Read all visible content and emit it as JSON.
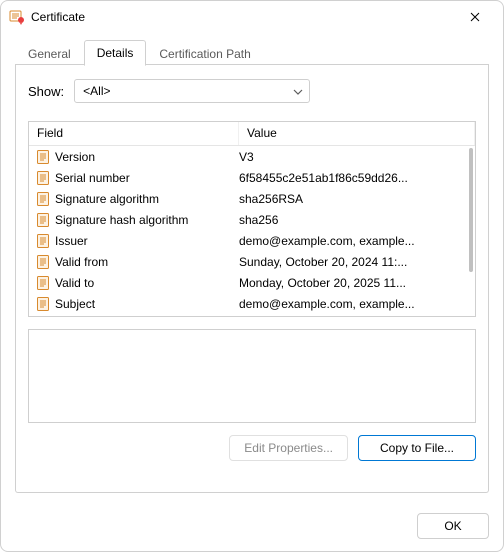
{
  "window": {
    "title": "Certificate"
  },
  "tabs": [
    {
      "id": "general",
      "label": "General"
    },
    {
      "id": "details",
      "label": "Details"
    },
    {
      "id": "certpath",
      "label": "Certification Path"
    }
  ],
  "active_tab": "details",
  "show": {
    "label": "Show:",
    "selected": "<All>"
  },
  "columns": {
    "field": "Field",
    "value": "Value"
  },
  "rows": [
    {
      "field": "Version",
      "value": "V3"
    },
    {
      "field": "Serial number",
      "value": "6f58455c2e51ab1f86c59dd26..."
    },
    {
      "field": "Signature algorithm",
      "value": "sha256RSA"
    },
    {
      "field": "Signature hash algorithm",
      "value": "sha256"
    },
    {
      "field": "Issuer",
      "value": "demo@example.com, example..."
    },
    {
      "field": "Valid from",
      "value": "Sunday, October 20, 2024 11:..."
    },
    {
      "field": "Valid to",
      "value": "Monday, October 20, 2025 11..."
    },
    {
      "field": "Subject",
      "value": "demo@example.com, example..."
    }
  ],
  "buttons": {
    "edit_properties": "Edit Properties...",
    "copy_to_file": "Copy to File...",
    "ok": "OK"
  },
  "colors": {
    "accent": "#0078d4",
    "border": "#cfcfcf",
    "icon_orange": "#d88a2e",
    "icon_fill": "#fdf2e3"
  }
}
